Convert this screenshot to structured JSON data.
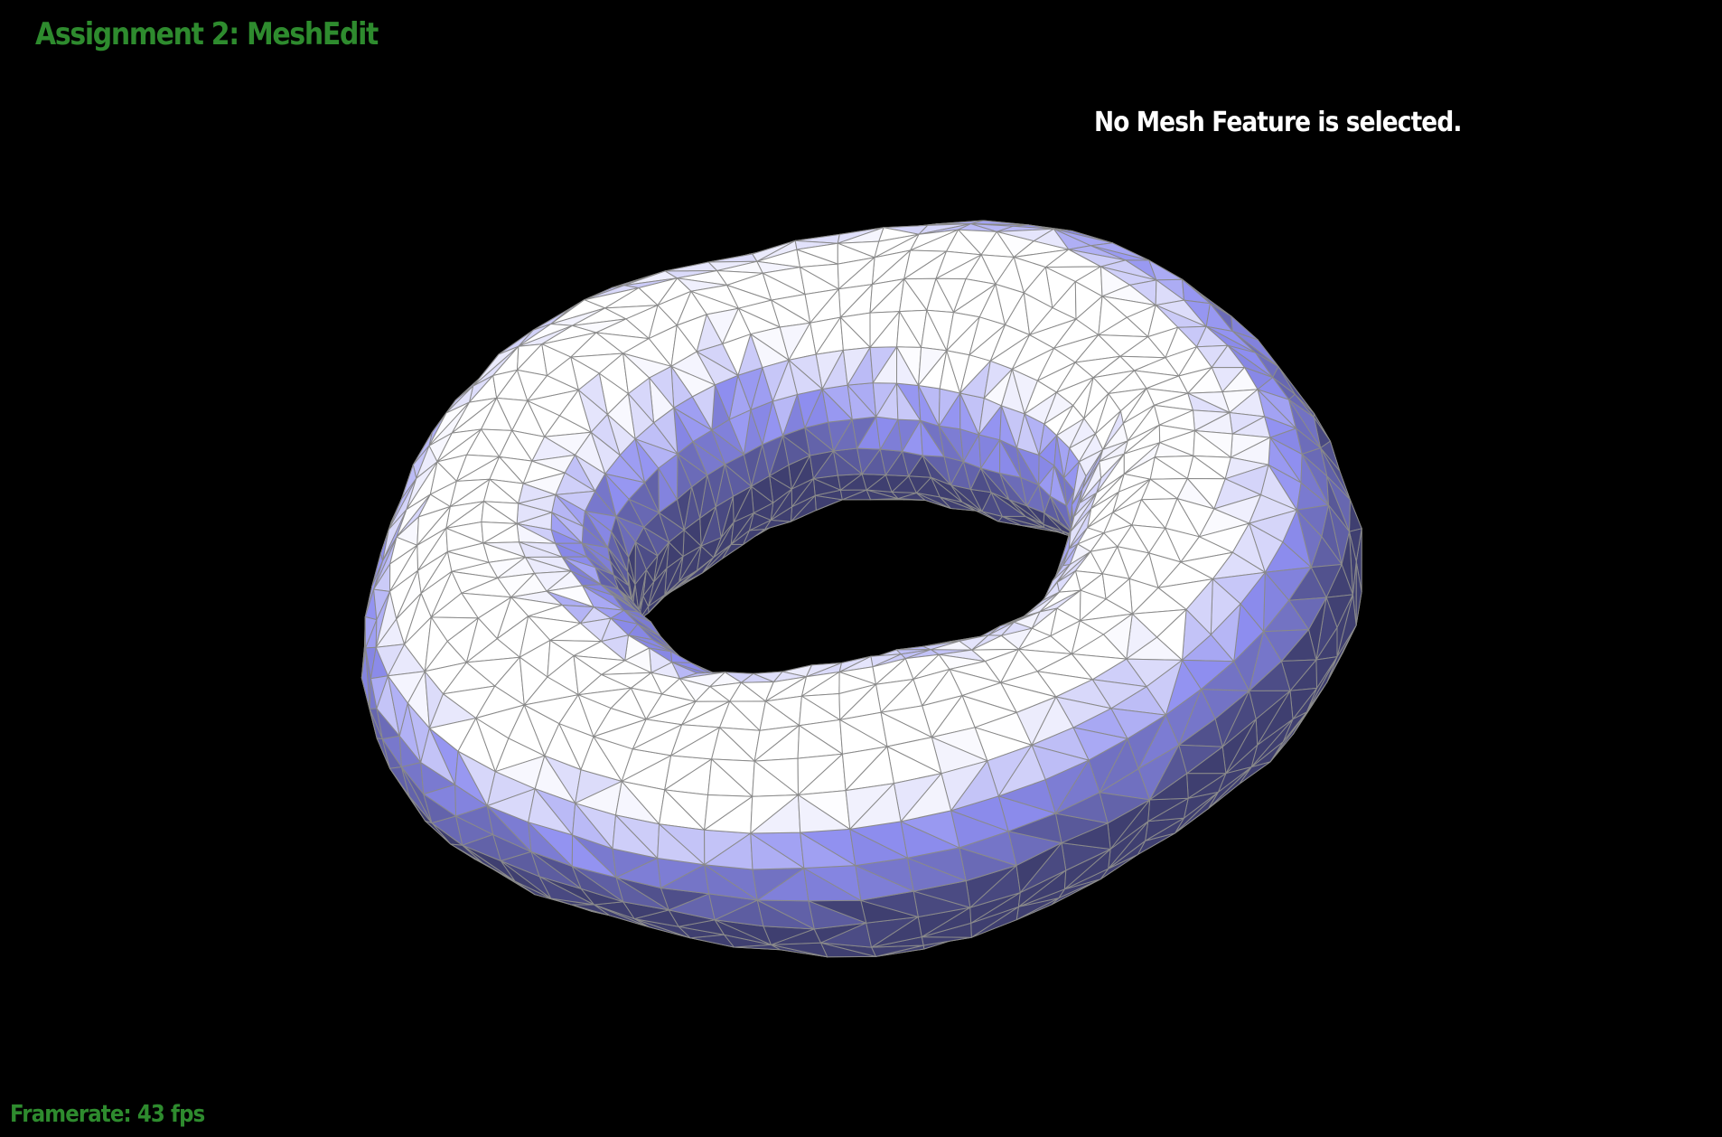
{
  "app": {
    "title": "Assignment 2: MeshEdit",
    "status_message": "No Mesh Feature is selected.",
    "framerate_text": "Framerate: 43 fps"
  },
  "colors": {
    "background": "#000000",
    "title": "#2e8b2e",
    "status_text": "#ffffff",
    "framerate": "#2e8b2e",
    "mesh_light": "#ffffff",
    "mesh_mid": "#8e8ef0",
    "mesh_dark": "#3f3f70",
    "mesh_wireframe": "#8a8a8a"
  },
  "viewport": {
    "object": "torus-mesh",
    "render_mode": "shaded-wireframe"
  }
}
